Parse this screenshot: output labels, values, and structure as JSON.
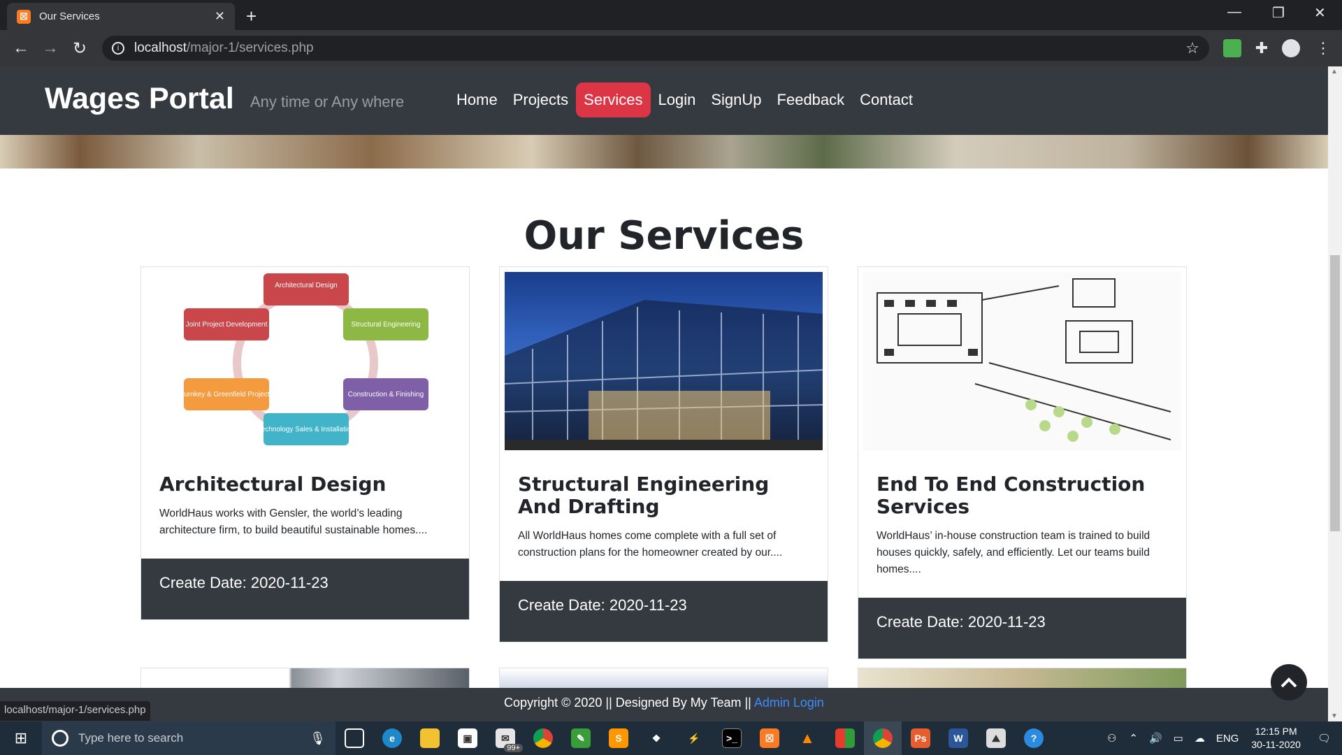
{
  "browser": {
    "tab_title": "Our Services",
    "tab_close": "✕",
    "new_tab": "+",
    "url_host": "localhost",
    "url_path": "/major-1/services.php",
    "status_url": "localhost/major-1/services.php"
  },
  "site": {
    "brand": "Wages Portal",
    "tagline": "Any time or Any where",
    "menu": [
      "Home",
      "Projects",
      "Services",
      "Login",
      "SignUp",
      "Feedback",
      "Contact"
    ],
    "active_menu": "Services",
    "page_title": "Our Services"
  },
  "cards": [
    {
      "title": "Architectural Design",
      "text": "WorldHaus works with Gensler, the world’s leading architecture firm, to build beautiful sustainable homes....",
      "footer": "Create Date: 2020-11-23",
      "diagram": [
        "Architectural Design",
        "Structural Engineering",
        "Construction & Finishing",
        "Technology Sales & Installation",
        "Turnkey & Greenfield Projects",
        "Joint Project Development"
      ]
    },
    {
      "title": "Structural Engineering And Drafting",
      "text": "All WorldHaus homes come complete with a full set of construction plans for the homeowner created by our....",
      "footer": "Create Date: 2020-11-23"
    },
    {
      "title": "End To End Construction Services",
      "text": "WorldHaus’ in-house construction team is trained to build houses quickly, safely, and efficiently. Let our teams build homes....",
      "footer": "Create Date: 2020-11-23"
    }
  ],
  "footer": {
    "copyright": "Copyright © 2020 || Designed By My Team ||",
    "admin_link": "Admin Login"
  },
  "taskbar": {
    "search_placeholder": "Type here to search",
    "badge": "99+",
    "lang": "ENG",
    "time": "12:15 PM",
    "date": "30-11-2020"
  }
}
